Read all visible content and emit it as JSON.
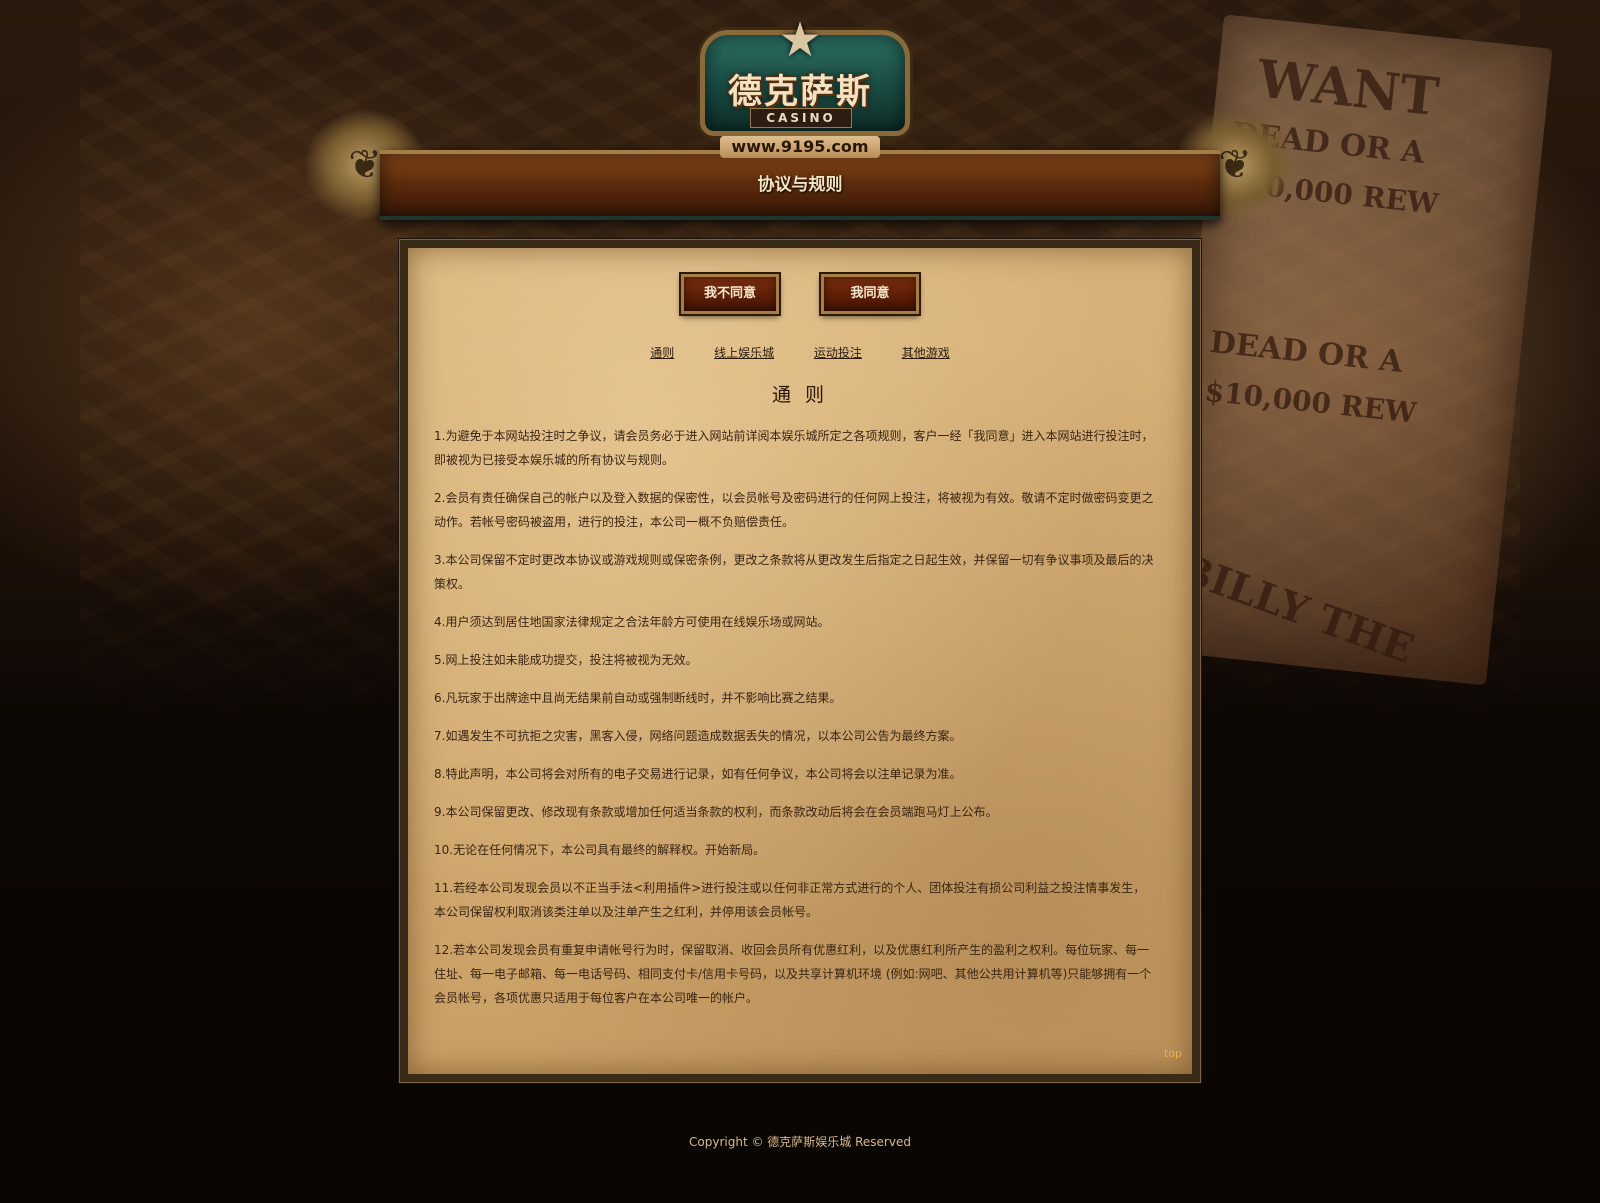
{
  "header": {
    "logo_title": "德克萨斯",
    "logo_subtitle": "CASINO",
    "logo_url": "www.9195.com",
    "page_title": "协议与规则"
  },
  "background": {
    "poster_line1": "WANT",
    "poster_line2": "DEAD OR A",
    "poster_line3": "$10,000 REW",
    "poster_line4": "BILLY THE"
  },
  "actions": {
    "disagree": "我不同意",
    "agree": "我同意"
  },
  "tabs": [
    {
      "label": "通则"
    },
    {
      "label": "线上娱乐城"
    },
    {
      "label": "运动投注"
    },
    {
      "label": "其他游戏"
    }
  ],
  "section": {
    "title": "通 则"
  },
  "rules": [
    "1.为避免于本网站投注时之争议，请会员务必于进入网站前详阅本娱乐城所定之各项规则，客户一经「我同意」进入本网站进行投注时，即被视为已接受本娱乐城的所有协议与规则。",
    "2.会员有责任确保自己的帐户以及登入数据的保密性，以会员帐号及密码进行的任何网上投注，将被视为有效。敬请不定时做密码变更之动作。若帐号密码被盗用，进行的投注，本公司一概不负赔偿责任。",
    "3.本公司保留不定时更改本协议或游戏规则或保密条例，更改之条款将从更改发生后指定之日起生效，并保留一切有争议事项及最后的决策权。",
    "4.用户须达到居住地国家法律规定之合法年龄方可使用在线娱乐场或网站。",
    "5.网上投注如未能成功提交，投注将被视为无效。",
    "6.凡玩家于出牌途中且尚无结果前自动或强制断线时，并不影响比赛之结果。",
    "7.如遇发生不可抗拒之灾害，黑客入侵，网络问题造成数据丢失的情况，以本公司公告为最终方案。",
    "8.特此声明，本公司将会对所有的电子交易进行记录，如有任何争议，本公司将会以注单记录为准。",
    "9.本公司保留更改、修改现有条款或增加任何适当条款的权利，而条款改动后将会在会员端跑马灯上公布。",
    "10.无论在任何情况下，本公司具有最终的解释权。开始新局。",
    "11.若经本公司发现会员以不正当手法<利用插件>进行投注或以任何非正常方式进行的个人、团体投注有损公司利益之投注情事发生，本公司保留权利取消该类注单以及注单产生之红利，并停用该会员帐号。",
    "12.若本公司发现会员有重复申请帐号行为时，保留取消、收回会员所有优惠红利，以及优惠红利所产生的盈利之权利。每位玩家、每一住址、每一电子邮箱、每一电话号码、相同支付卡/信用卡号码，以及共享计算机环境 (例如:网吧、其他公共用计算机等)只能够拥有一个会员帐号，各项优惠只适用于每位客户在本公司唯一的帐户。"
  ],
  "top_link": "top",
  "footer": {
    "copyright": "Copyright © 德克萨斯娱乐城 Reserved"
  },
  "colors": {
    "parchment": "#d4ad73",
    "button": "#5a1d06",
    "title_bar": "#6a3210",
    "top_link": "#e6b24a"
  }
}
